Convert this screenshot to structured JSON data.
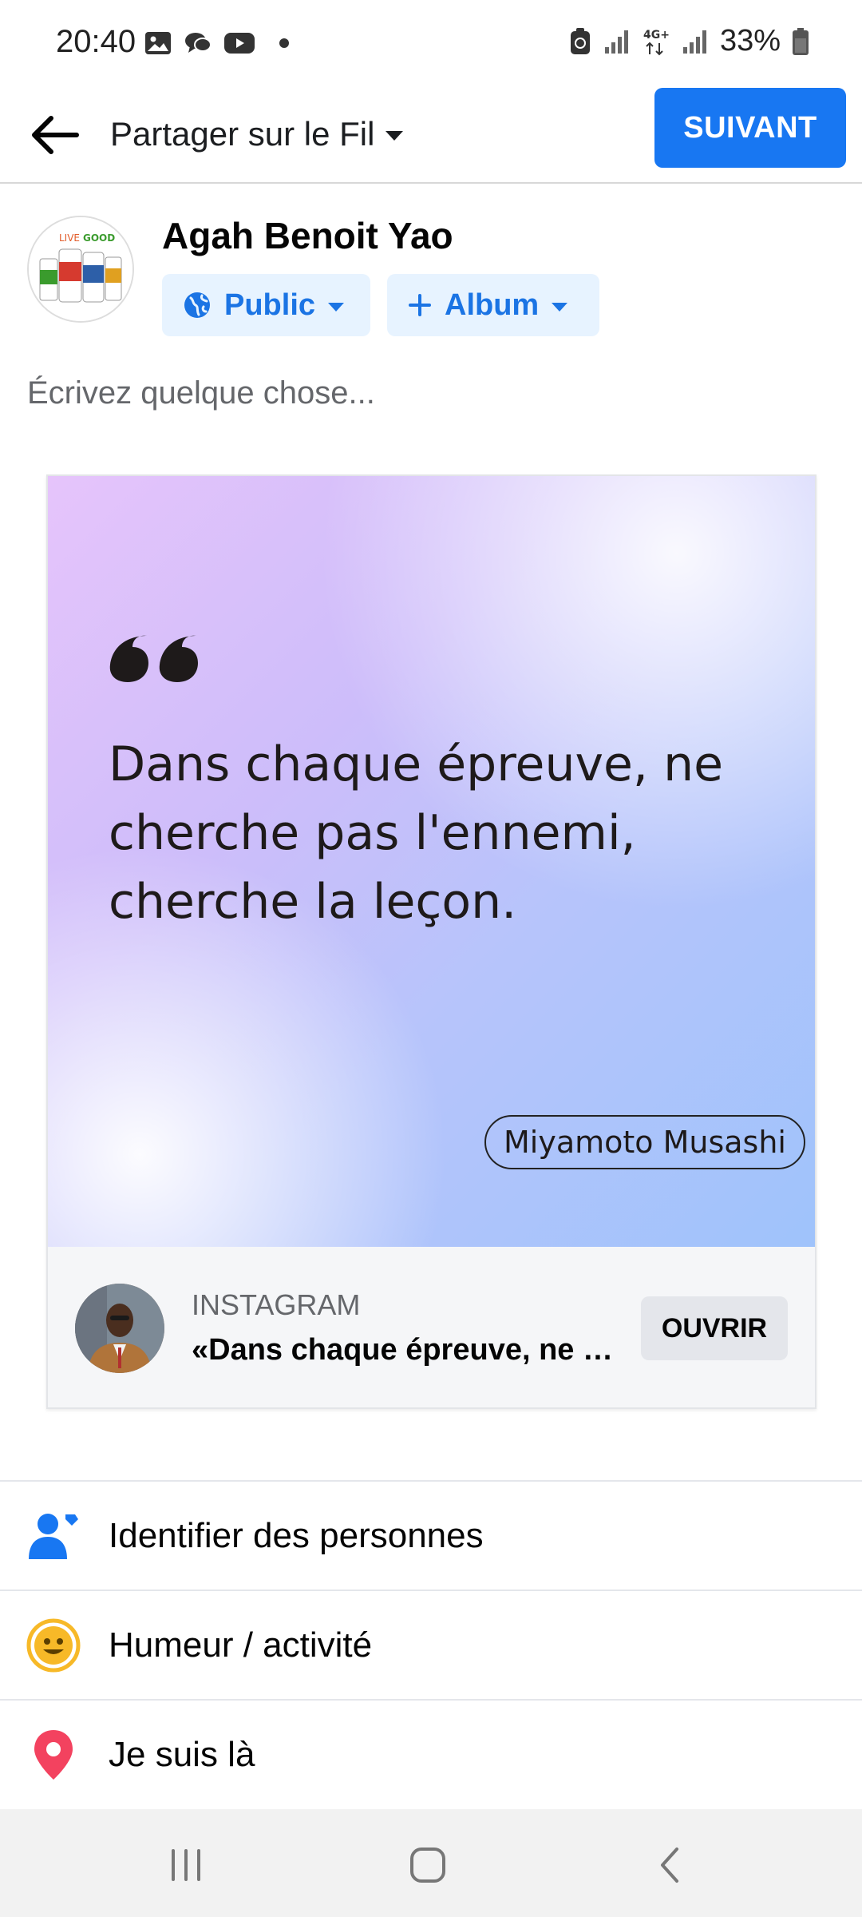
{
  "status_bar": {
    "time": "20:40",
    "left_icons": [
      "gallery-icon",
      "chat-bubble-icon",
      "youtube-icon"
    ],
    "battery": "33%",
    "network": "4G+"
  },
  "header": {
    "title": "Partager sur le Fil",
    "next_label": "SUIVANT"
  },
  "author": {
    "name": "Agah Benoit Yao",
    "privacy_label": "Public",
    "album_label": "Album"
  },
  "composer": {
    "placeholder": "Écrivez quelque chose..."
  },
  "shared_post": {
    "quote": "Dans chaque épreuve, ne cherche pas l'ennemi, cherche la leçon.",
    "quote_author": "Miyamoto Musashi",
    "source": "INSTAGRAM",
    "title": "«Dans chaque épreuve, ne cherche pas l'ennemi, cherche la leçon.»",
    "open_label": "OUVRIR"
  },
  "actions": [
    {
      "label": "Identifier des personnes",
      "icon": "tag-people-icon",
      "color": "#1877f2"
    },
    {
      "label": "Humeur / activité",
      "icon": "smiley-icon",
      "color": "#f7b928"
    },
    {
      "label": "Je suis là",
      "icon": "location-pin-icon",
      "color": "#f3425f"
    }
  ],
  "colors": {
    "accent": "#1877f2",
    "chip_bg": "#e7f3ff"
  }
}
